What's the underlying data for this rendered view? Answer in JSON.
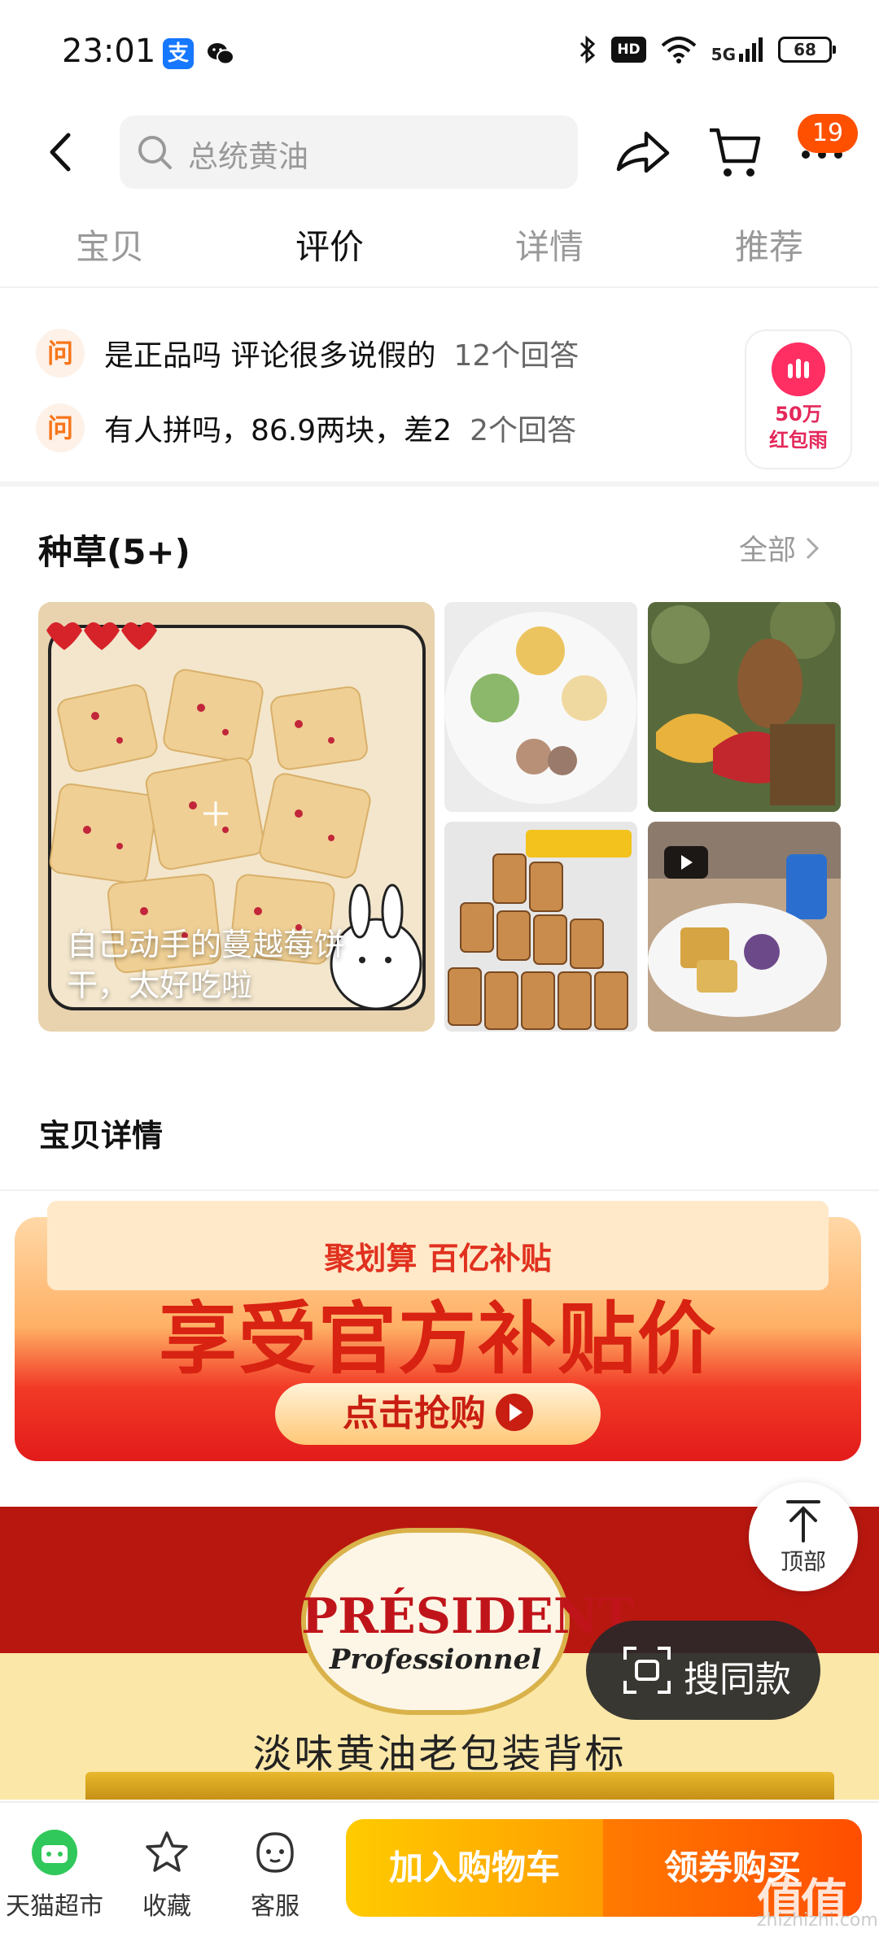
{
  "status_bar": {
    "time": "23:01",
    "alipay_glyph": "支",
    "hd": "HD",
    "network": "5G",
    "battery": "68"
  },
  "header": {
    "search_placeholder": "总统黄油",
    "cart_count": "19"
  },
  "tabs": [
    {
      "label": "宝贝"
    },
    {
      "label": "评价"
    },
    {
      "label": "详情"
    },
    {
      "label": "推荐"
    }
  ],
  "qa": {
    "icon_label": "问",
    "items": [
      {
        "question": "是正品吗 评论很多说假的",
        "answers": "12个回答"
      },
      {
        "question": "有人拼吗，86.9两块，差2",
        "answers": "2个回答"
      }
    ]
  },
  "red_rain": {
    "line1": "50万",
    "line2": "红包雨"
  },
  "zhongcao": {
    "title": "种草(5+)",
    "all_label": "全部",
    "caption": "自己动手的蔓越莓饼干，太好吃啦"
  },
  "detail": {
    "title": "宝贝详情"
  },
  "banner": {
    "sub": "聚划算 百亿补贴",
    "main": "享受官方补贴价",
    "button": "点击抢购"
  },
  "product": {
    "brand": "PRÉSIDENT",
    "brand_sub": "Professionnel",
    "desc": "淡味黄油老包装背标"
  },
  "floating": {
    "top_label": "顶部",
    "search_same_label": "搜同款"
  },
  "bottom_bar": {
    "tmall_label": "天猫超市",
    "fav_label": "收藏",
    "service_label": "客服",
    "add_cart": "加入购物车",
    "buy": "领券购买"
  },
  "watermark": {
    "main": "值值值",
    "sub": "zhizhizhi.com"
  },
  "colors": {
    "accent": "#ff5000",
    "qa_icon": "#f7761c",
    "red_rain": "#ff2e63"
  }
}
